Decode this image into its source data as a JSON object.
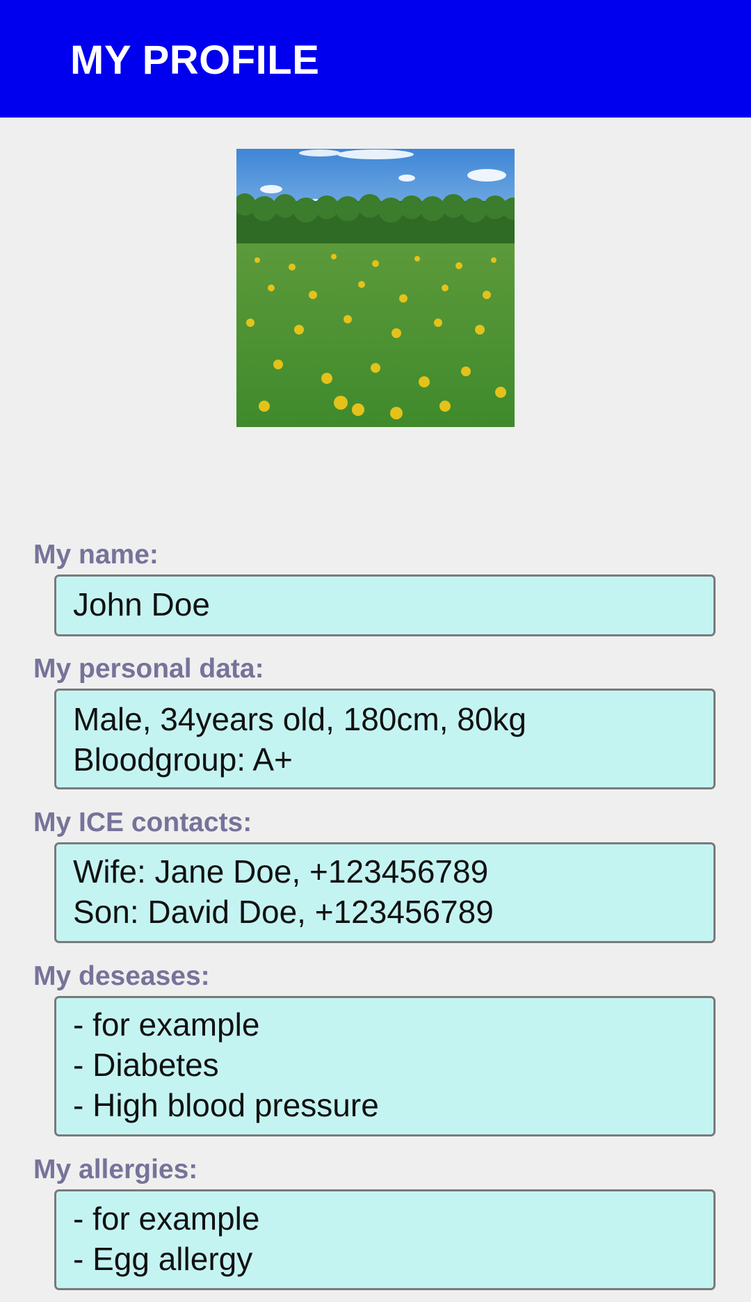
{
  "header": {
    "title": "MY PROFILE",
    "background_color": "#0000ee"
  },
  "profile_photo": {
    "description_icon": "profile-photo"
  },
  "fields": {
    "name": {
      "label": "My name:",
      "value": "John Doe"
    },
    "personal_data": {
      "label": "My personal data:",
      "value": "Male, 34years old, 180cm, 80kg\n Bloodgroup: A+"
    },
    "ice_contacts": {
      "label": "My ICE contacts:",
      "value": "Wife: Jane Doe, +123456789\nSon: David Doe, +123456789"
    },
    "diseases": {
      "label": "My deseases:",
      "value": "- for example\n- Diabetes\n- High blood pressure"
    },
    "allergies": {
      "label": "My allergies:",
      "value": "- for example\n- Egg allergy"
    }
  },
  "colors": {
    "label": "#76739a",
    "field_background": "#c4f4f2",
    "field_border": "#7a7a7a",
    "page_background": "#efefef"
  }
}
